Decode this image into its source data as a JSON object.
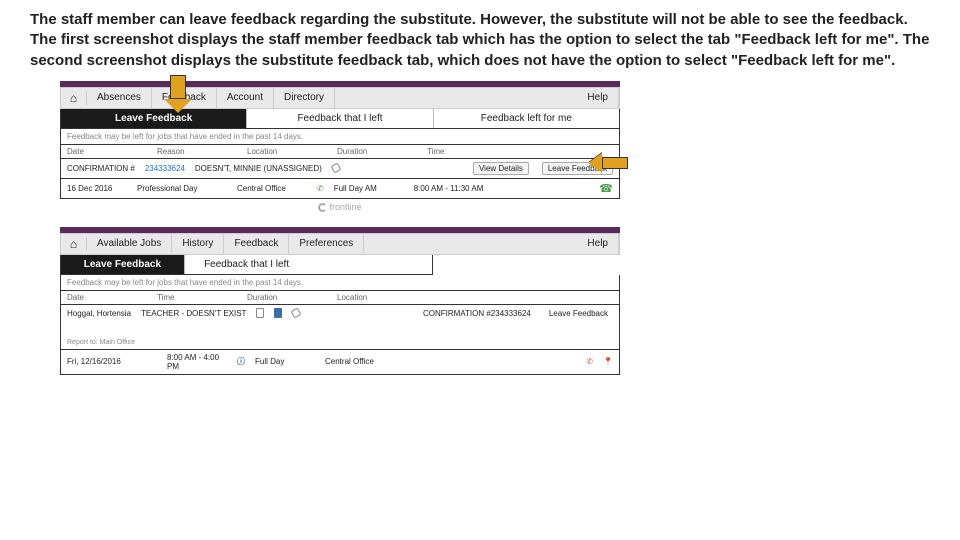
{
  "description": "The staff member can leave feedback regarding the substitute. However, the substitute will not be able to see the feedback. The first screenshot displays the staff member feedback tab which has the option to select the tab \"Feedback left for me\". The second screenshot displays the substitute feedback tab, which does not have the option to select \"Feedback left for me\".",
  "shot1": {
    "nav": {
      "home": "⌂",
      "items": [
        "Absences",
        "Feedback",
        "Account",
        "Directory"
      ],
      "help": "Help"
    },
    "tabs": [
      "Leave Feedback",
      "Feedback that I left",
      "Feedback left for me"
    ],
    "note": "Feedback may be left for jobs that have ended in the past 14 days.",
    "headers": [
      "Date",
      "Reason",
      "Location",
      "Duration",
      "Time"
    ],
    "row1": {
      "conf": "CONFIRMATION #",
      "num": "234333624",
      "name": "DOESN'T, MINNIE (UNASSIGNED)",
      "view": "View Details",
      "leave": "Leave Feedback"
    },
    "row2": {
      "date": "16 Dec 2016",
      "reason": "Professional Day",
      "loc": "Central Office",
      "dur": "Full Day AM",
      "time": "8:00 AM - 11:30 AM"
    },
    "footer": "frontline"
  },
  "shot2": {
    "nav": {
      "home": "⌂",
      "items": [
        "Available Jobs",
        "History",
        "Feedback",
        "Preferences"
      ],
      "help": "Help"
    },
    "tabs": [
      "Leave Feedback",
      "Feedback that I left"
    ],
    "note": "Feedback may be left for jobs that have ended in the past 14 days.",
    "headers": [
      "Date",
      "Time",
      "Duration",
      "Location"
    ],
    "row1": {
      "name": "Hoggal, Hortensia",
      "role": "TEACHER - DOESN'T EXIST",
      "conf": "CONFIRMATION #234333624",
      "leave": "Leave Feedback",
      "report": "Report to: Main Office"
    },
    "row2": {
      "date": "Fri, 12/16/2016",
      "time": "8:00 AM - 4:00 PM",
      "dur": "Full Day",
      "loc": "Central Office"
    }
  }
}
